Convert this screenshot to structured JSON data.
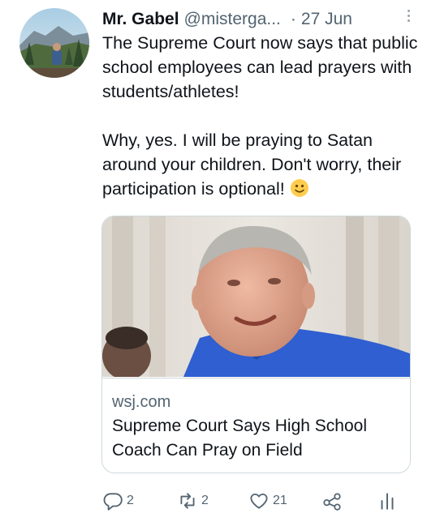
{
  "tweet": {
    "author_name": "Mr. Gabel",
    "handle": "@misterga...",
    "separator": "·",
    "timestamp": "27 Jun",
    "text": "The Supreme Court now says that public school employees can lead prayers with students/athletes!\n\nWhy, yes. I will be praying to Satan around your children. Don't worry, their participation is optional!",
    "emoji": "slightly-smiling-face"
  },
  "card": {
    "domain": "wsj.com",
    "title": "Supreme Court Says High School Coach Can Pray on Field"
  },
  "actions": {
    "reply_count": "2",
    "retweet_count": "2",
    "like_count": "21"
  },
  "icons": [
    "more-icon",
    "reply-icon",
    "retweet-icon",
    "like-icon",
    "share-icon",
    "analytics-icon"
  ],
  "colors": {
    "text": "#0f1419",
    "secondary": "#536471",
    "border": "#cfd9de"
  }
}
